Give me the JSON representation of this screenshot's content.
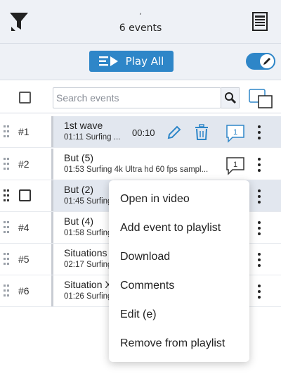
{
  "header": {
    "subtitle": ",",
    "title": "6 events",
    "filter_icon": "filter-icon",
    "list_view_icon": "list-view-icon"
  },
  "toolbar": {
    "play_all_label": "Play All",
    "play_all_icon": "playlist-play-icon",
    "edit_mode_on": true
  },
  "search": {
    "placeholder": "Search events",
    "value": ""
  },
  "colors": {
    "accent": "#2e86c8",
    "header_bg": "#eef1f6",
    "selected_row_bg": "#e2e7ef"
  },
  "events": [
    {
      "index": "#1",
      "title": "1st wave",
      "meta": "01:11 Surfing ...",
      "duration": "00:10",
      "comments": "1",
      "selected": true,
      "show_actions": true
    },
    {
      "index": "#2",
      "title": "But (5)",
      "meta": "01:53 Surfing 4k Ultra hd 60 fps sampl...",
      "comments": "1",
      "selected": false
    },
    {
      "index": "",
      "title": "But (2)",
      "meta": "01:45 Surfing",
      "selected": true,
      "checkbox": true
    },
    {
      "index": "#4",
      "title": "But (4)",
      "meta": "01:58 Surfing",
      "selected": false
    },
    {
      "index": "#5",
      "title": "Situations",
      "meta": "02:17 Surfing",
      "selected": false
    },
    {
      "index": "#6",
      "title": "Situation X",
      "meta": "01:26 Surfing",
      "selected": false
    }
  ],
  "context_menu": {
    "items": [
      "Open in video",
      "Add event to playlist",
      "Download",
      "Comments",
      "Edit (e)",
      "Remove from playlist"
    ]
  }
}
